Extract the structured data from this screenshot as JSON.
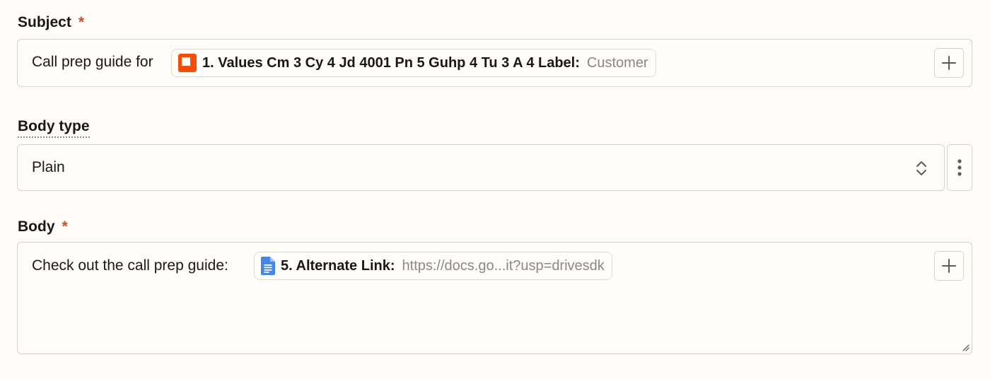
{
  "subject": {
    "label": "Subject",
    "required_mark": "*",
    "prefix_text": "Call prep guide for",
    "pill": {
      "icon": "app-orange-square-icon",
      "key": "1. Values Cm 3 Cy 4 Jd 4001 Pn 5 Guhp 4 Tu 3 A 4 Label:",
      "value": "Customer"
    },
    "insert_icon": "plus-icon"
  },
  "body_type": {
    "label": "Body type",
    "selected": "Plain",
    "select_icon": "chevron-up-down-icon",
    "menu_icon": "kebab-vertical-icon"
  },
  "body": {
    "label": "Body",
    "required_mark": "*",
    "prefix_text": "Check out the call prep guide:",
    "pill": {
      "icon": "google-docs-icon",
      "key": "5. Alternate Link:",
      "value": "https://docs.go...it?usp=drivesdk"
    },
    "insert_icon": "plus-icon",
    "resize_icon": "resize-handle-icon"
  },
  "colors": {
    "required": "#e0481c",
    "app_icon": "#ff4a00",
    "docs_icon": "#4285f4",
    "border": "#d6d2cc",
    "background": "#fdfcf9"
  }
}
